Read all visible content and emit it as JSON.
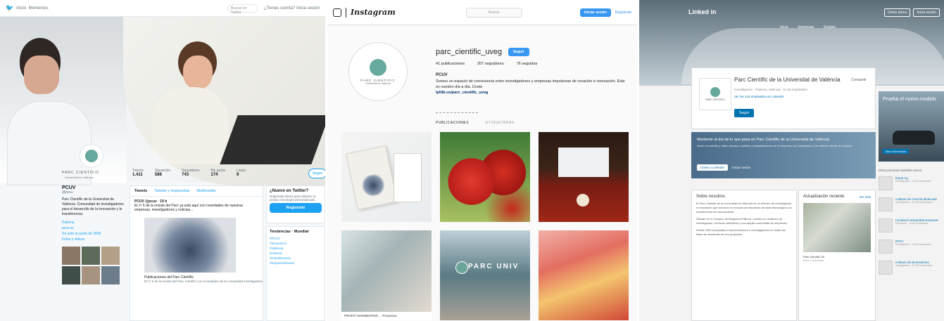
{
  "twitter": {
    "topbar": {
      "home": "Inicio",
      "moments": "Momentos",
      "search_placeholder": "Buscar en Twitter",
      "login": "¿Tienes cuenta? Inicia sesión"
    },
    "logo": {
      "name": "PARC CIENTIFIC",
      "sub": "Universitat de València"
    },
    "stats": [
      {
        "label": "Tweets",
        "value": "1.411"
      },
      {
        "label": "Siguiendo",
        "value": "588"
      },
      {
        "label": "Seguidores",
        "value": "743"
      },
      {
        "label": "Me gusta",
        "value": "174"
      },
      {
        "label": "Listas",
        "value": "9"
      }
    ],
    "follow_label": "Seguir",
    "profile": {
      "name": "PCUV",
      "handle": "@pcuv",
      "bio": "Parc Científic de la Universitat de València. Comunidad de investigadores para el desarrollo de la innovación y la transferencia.",
      "location": "Paterna",
      "website": "pcuv.es",
      "joined": "Se unió en junio de 2009",
      "photos_label": "Fotos y videos"
    },
    "feed": {
      "tabs": [
        "Tweets",
        "Tweets y respuestas",
        "Multimedia"
      ],
      "tweet": {
        "author": "PCUV @pcuv · 19 h",
        "text": "El nº 5 de la revista del Parc ya está aquí con novedades de nuestras empresas, investigadores y noticias...",
        "card_title": "Publicaciones del Parc Científic",
        "card_desc": "El nº 5 de la revista del Parc Científic con novedades de la comunidad investigadora"
      }
    },
    "new_box": {
      "title": "¿Nuevo en Twitter?",
      "text": "Regístrate ahora para obtener tu propia cronología personalizada.",
      "button": "Regístrate"
    },
    "trends": {
      "title": "Tendencias · Mundial",
      "items": [
        "#PCUV",
        "#Innovación",
        "#València",
        "#Ciencia",
        "#Transferencia",
        "#Emprendimiento"
      ]
    }
  },
  "instagram": {
    "brand": "Instagram",
    "search_placeholder": "Buscar",
    "login": "Iniciar sesión",
    "signup": "Regístrate",
    "avatar": {
      "name": "PARC CIENTIFIC",
      "sub": "Universitat de València"
    },
    "username": "parc_cientific_uveg",
    "follow_label": "Seguir",
    "counts": {
      "posts": "41 publicaciones",
      "followers": "207 seguidores",
      "following": "76 seguidos"
    },
    "name": "PCUV",
    "bio": "Somos un espacio de convivencia entre investigadores y empresas impulsoras de creación e innovación. Este es nuestro día a día. Únete",
    "link": "lpfdb.co/parc_cientific_uveg",
    "tabs": {
      "posts": "PUBLICACIONES",
      "tagged": "ETIQUETADAS"
    },
    "post_caption": "PROFIT HARWESTING ... Proyectos",
    "post_sign": "PARC UNIV"
  },
  "linkedin": {
    "brand": "Linked in",
    "nav": [
      "Inicio",
      "Empresas",
      "Empleo"
    ],
    "header_buttons": [
      "Únete ahora",
      "Inicia sesión"
    ],
    "logo": "PARC CIENTIFIC",
    "company": "Parc Científic de la Universitat de València",
    "share": "Compartir",
    "meta": "Investigación · Paterna, Valencia · 11-50 empleados",
    "employees": "Ver los 143 empleados en LinkedIn",
    "follow": "Seguir",
    "banner": {
      "head": "Mantente al día de lo que pasa en Parc Científic de la Universitat de València",
      "sub": "Únete a LinkedIn y obtén acceso a noticias y actualizaciones de la empresa, sus empleados y las últimas ofertas de empleo.",
      "button": "Únete a LinkedIn",
      "link": "Iniciar sesión"
    },
    "about": {
      "head": "Sobre nosotros",
      "paragraphs": [
        "El Parc Científic de la Universitat de València es un entorno de investigación e innovación que favorece la creación de empresas de base tecnológica y la transferencia de conocimiento.",
        "Situado en el Campus de Burjassot-Paterna, cuenta con institutos de investigación, servicios científicos y una amplia comunidad de empresas.",
        "Desde 2009 acompaña a emprendedores e investigadores en todas las fases de desarrollo de sus proyectos."
      ]
    },
    "update": {
      "head": "Actualización reciente",
      "more": "Ver más",
      "caption": "Parc Científic UV",
      "caption_sub": "hace 2 semanas"
    },
    "ad": {
      "title": "Prueba el nuevo modelo",
      "button": "Más información"
    },
    "people_head": "Otras personas también vieron",
    "people": [
      {
        "name": "Espai Ag",
        "sub": "Investigación · 11-50 empleados"
      },
      {
        "name": "Instituto de Ciencia Molecular",
        "sub": "Investigación · 51-200 empleados"
      },
      {
        "name": "Fundació Universitat-Empresa",
        "sub": "Educación · 11-50 empleados"
      },
      {
        "name": "IRTIC",
        "sub": "Investigación · 11-50 empleados"
      },
      {
        "name": "Instituto de Biomedicina",
        "sub": "Investigación · 51-200 empleados"
      }
    ]
  }
}
